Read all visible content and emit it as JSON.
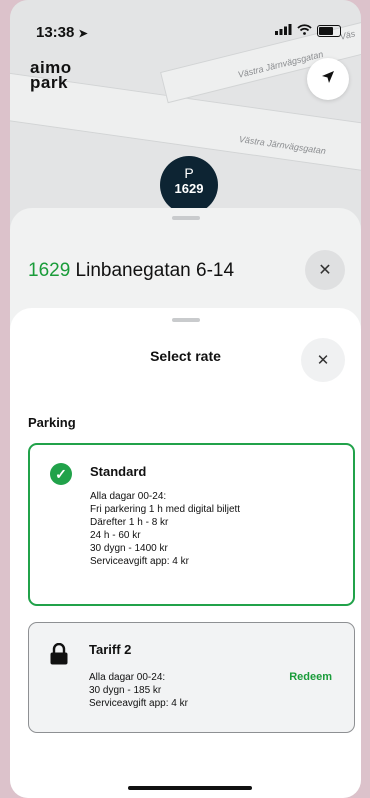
{
  "status_bar": {
    "time": "13:38",
    "location_icon": "location-arrow-icon",
    "signal_icon": "signal-icon",
    "wifi_icon": "wifi-icon",
    "battery_icon": "battery-icon"
  },
  "map": {
    "logo_line1": "aimo",
    "logo_line2": "park",
    "street_1": "Västra Järnvägsgatan",
    "street_2": "Västra Järnvägsgatan",
    "street_3": "Väs",
    "pin_letter": "P",
    "pin_number": "1629"
  },
  "background_sheet": {
    "zone_number": "1629",
    "zone_name": " Linbanegatan 6-14"
  },
  "modal": {
    "title": "Select rate",
    "section_label": "Parking",
    "rates": [
      {
        "name": "Standard",
        "selected": true,
        "lines": [
          "Alla dagar 00-24:",
          "Fri parkering 1 h med digital biljett",
          "Därefter 1 h - 8 kr",
          "24 h - 60 kr",
          "30 dygn - 1400 kr",
          "Serviceavgift app: 4 kr"
        ]
      },
      {
        "name": "Tariff 2",
        "selected": false,
        "locked": true,
        "action": "Redeem",
        "lines": [
          "Alla dagar 00-24:",
          "30 dygn - 185 kr",
          "Serviceavgift app: 4 kr"
        ]
      }
    ]
  },
  "colors": {
    "accent": "#21a24a",
    "pin": "#0d2433"
  }
}
